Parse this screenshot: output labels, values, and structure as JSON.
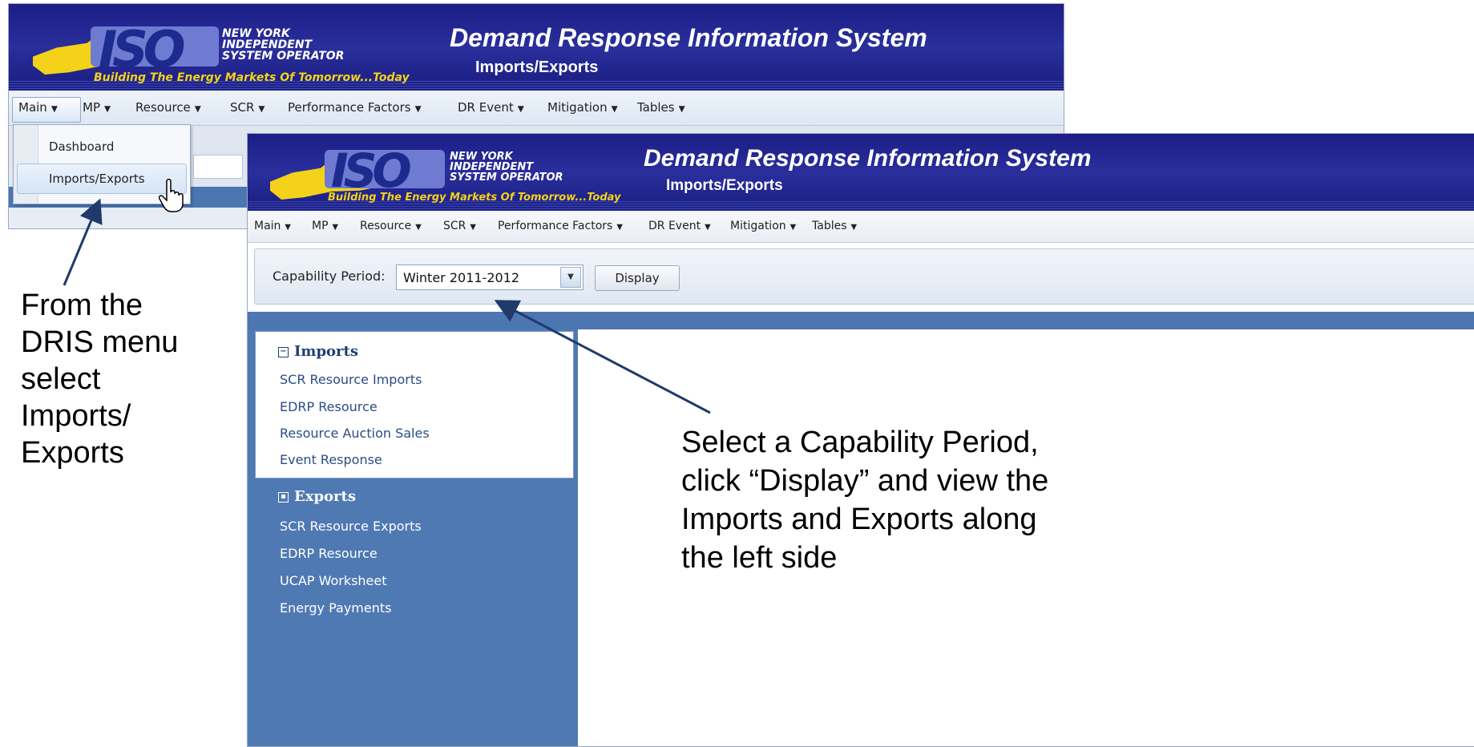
{
  "app": {
    "title": "Demand Response Information System",
    "subtitle": "Imports/Exports",
    "logo": {
      "iso": "ISO",
      "org_lines": [
        "NEW YORK",
        "INDEPENDENT",
        "SYSTEM OPERATOR"
      ],
      "tagline": "Building The Energy Markets Of Tomorrow...Today"
    }
  },
  "menu": {
    "items": [
      "Main",
      "MP",
      "Resource",
      "SCR",
      "Performance Factors",
      "DR Event",
      "Mitigation",
      "Tables"
    ],
    "main_dropdown": [
      "Dashboard",
      "Imports/Exports"
    ]
  },
  "toolbar": {
    "capability_label": "Capability Period:",
    "capability_value": "Winter 2011-2012",
    "display_button": "Display"
  },
  "nav": {
    "imports": {
      "title": "Imports",
      "links": [
        "SCR Resource Imports",
        "EDRP Resource",
        "Resource Auction Sales",
        "Event Response"
      ]
    },
    "exports": {
      "title": "Exports",
      "links": [
        "SCR Resource Exports",
        "EDRP Resource",
        "UCAP Worksheet",
        "Energy Payments"
      ]
    }
  },
  "annotations": {
    "left_lines": [
      "From the",
      "DRIS menu",
      "select",
      "Imports/",
      "Exports"
    ],
    "right_lines": [
      "Select a Capability Period,",
      "click “Display” and view the",
      "Imports and Exports along",
      "the left side"
    ]
  },
  "colors": {
    "banner": "#1c1d86",
    "nav_blue": "#4f79b3",
    "logo_yellow": "#f4d21a",
    "arrow": "#1f3a6b"
  },
  "icons": [
    "collapse-icon",
    "expand-icon",
    "dropdown-arrow-icon",
    "hand-cursor-icon",
    "caret-down-icon"
  ]
}
